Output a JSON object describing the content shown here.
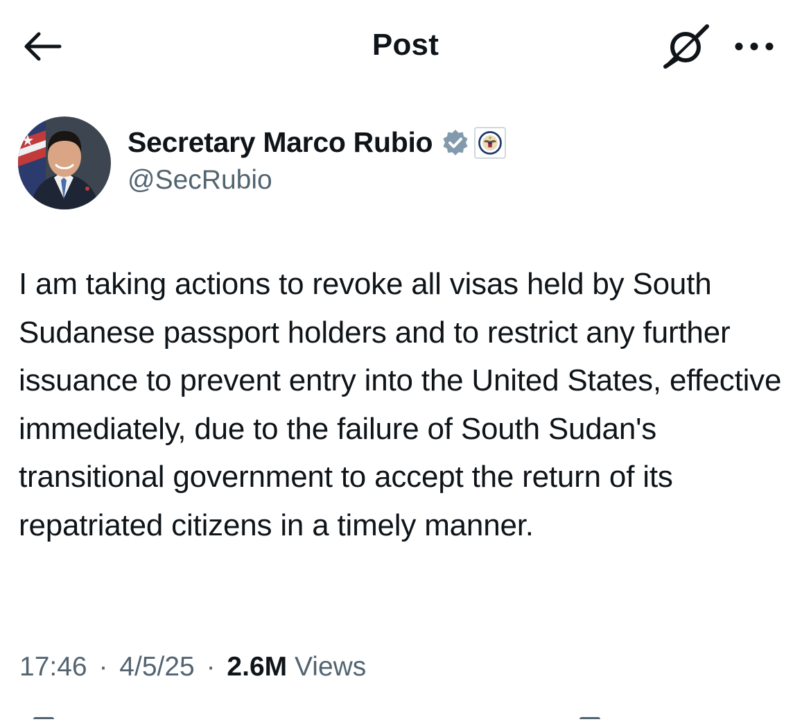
{
  "header": {
    "title": "Post",
    "back_icon": "arrow-left-icon",
    "grok_icon": "grok-slash-icon",
    "more_icon": "more-horizontal-icon"
  },
  "author": {
    "display_name": "Secretary Marco Rubio",
    "handle": "@SecRubio",
    "verified_badge_color": "#829aab",
    "affiliation_icon": "us-state-department-seal-icon"
  },
  "post": {
    "text": "I am taking actions to revoke all visas held by South Sudanese passport holders and to restrict any further issuance to prevent entry into the United States, effective immediately, due to the failure of South Sudan's transitional government to accept the return of its repatriated citizens in a timely manner."
  },
  "meta": {
    "time": "17:46",
    "date": "4/5/25",
    "separator": "·",
    "views_count": "2.6M",
    "views_label": "Views"
  },
  "colors": {
    "text_primary": "#0f1419",
    "text_secondary": "#536471",
    "background": "#ffffff"
  }
}
